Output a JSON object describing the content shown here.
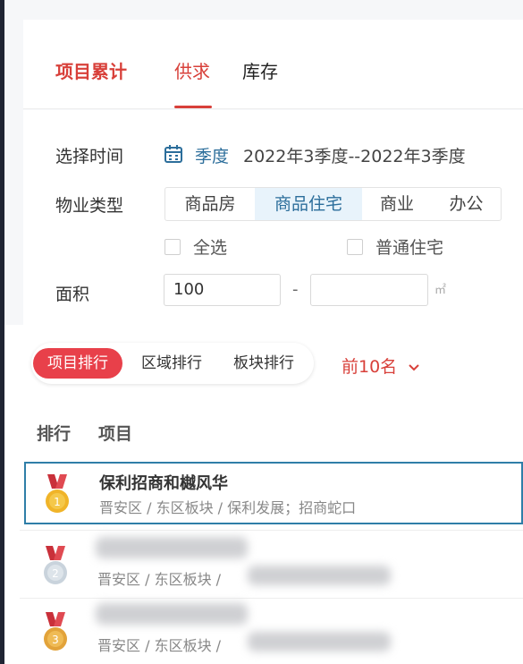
{
  "tabs": {
    "items": [
      "项目累计",
      "供求",
      "库存"
    ],
    "active_index": 1
  },
  "filters": {
    "time_label": "选择时间",
    "time_mode": "季度",
    "time_range": "2022年3季度--2022年3季度",
    "property_label": "物业类型",
    "property_options": [
      "商品房",
      "商品住宅",
      "商业",
      "办公"
    ],
    "property_selected": "商品住宅",
    "check_all": "全选",
    "check_ordinary": "普通住宅",
    "area_label": "面积",
    "area_min": "100",
    "area_max": "",
    "area_dash": "-",
    "area_unit": "㎡"
  },
  "ranking": {
    "modes": [
      "项目排行",
      "区域排行",
      "板块排行"
    ],
    "active_mode": "项目排行",
    "top_n": "前10名",
    "col_rank": "排行",
    "col_project": "项目",
    "rows": [
      {
        "rank": 1,
        "name": "保利招商和樾风华",
        "sub": "晋安区 / 东区板块 / 保利发展；招商蛇口"
      },
      {
        "rank": 2,
        "name": "",
        "sub": "晋安区 / 东区板块 / "
      },
      {
        "rank": 3,
        "name": "",
        "sub": "晋安区 / 东区板块 / "
      }
    ]
  },
  "colors": {
    "brand_red": "#d8403a",
    "accent_blue": "#2c6e9b",
    "medal_gold": "#f0b429",
    "medal_silver": "#c9d3dc",
    "medal_bronze": "#e2a33a",
    "ribbon_red": "#c9303a"
  }
}
